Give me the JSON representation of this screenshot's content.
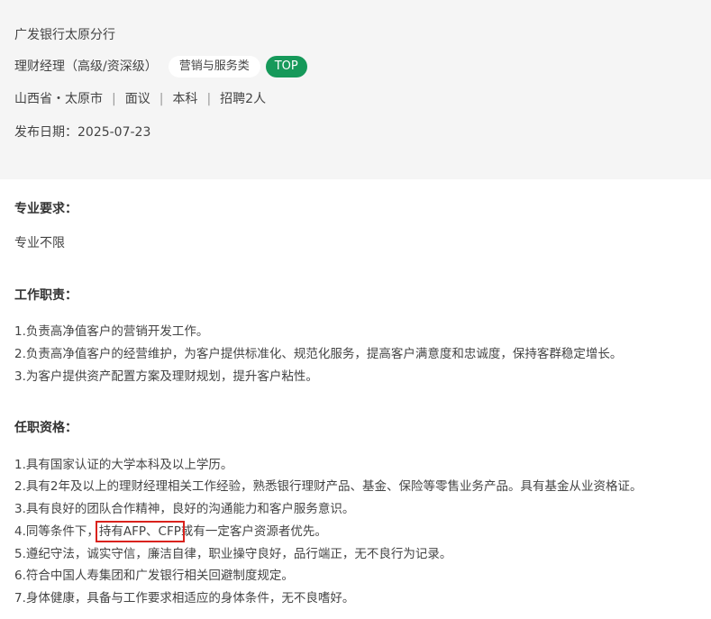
{
  "job": {
    "company": "广发银行太原分行",
    "title": "理财经理（高级/资深级）",
    "category": "营销与服务类",
    "top_tag": "TOP",
    "location": "山西省・太原市",
    "salary": "面议",
    "education": "本科",
    "headcount": "招聘2人",
    "publish_date": "发布日期：2025-07-23"
  },
  "requirements": {
    "major_title": "专业要求：",
    "major_text": "专业不限",
    "duties_title": "工作职责：",
    "duties": [
      "1.负责高净值客户的营销开发工作。",
      "2.负责高净值客户的经营维护，为客户提供标准化、规范化服务，提高客户满意度和忠诚度，保持客群稳定增长。",
      "3.为客户提供资产配置方案及理财规划，提升客户粘性。"
    ],
    "qual_title": "任职资格：",
    "quals": [
      "1.具有国家认证的大学本科及以上学历。",
      "2.具有2年及以上的理财经理相关工作经验，熟悉银行理财产品、基金、保险等零售业务产品。具有基金从业资格证。",
      "3.具有良好的团队合作精神，良好的沟通能力和客户服务意识。",
      "4.同等条件下，",
      "5.遵纪守法，诚实守信，廉洁自律，职业操守良好，品行端正，无不良行为记录。",
      "6.符合中国人寿集团和广发银行相关回避制度规定。",
      "7.身体健康，具备与工作要求相适应的身体条件，无不良嗜好。"
    ],
    "qual4_highlight": "持有AFP、CFP",
    "qual4_rest": "或有一定客户资源者优先。"
  }
}
